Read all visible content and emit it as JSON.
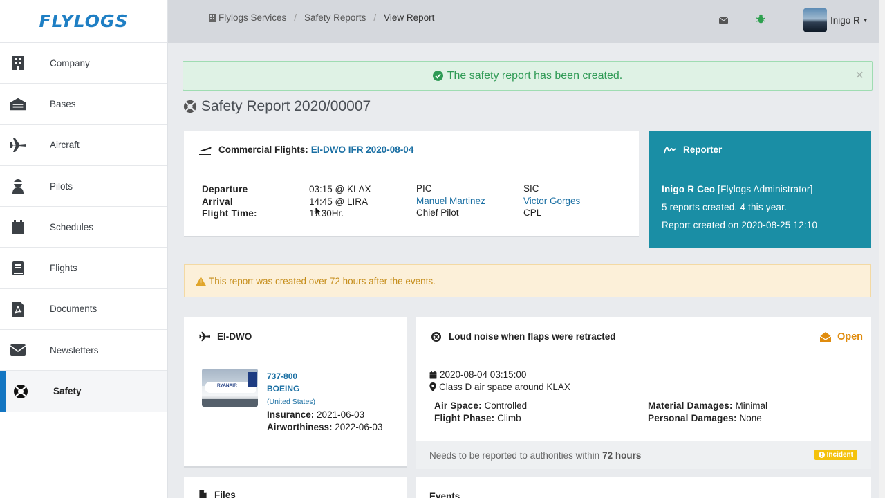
{
  "brand": {
    "logo_text": "FLYLOGS",
    "accent_color": "#1f7fc4"
  },
  "sidebar": {
    "items": [
      {
        "label": "Company",
        "icon": "building-icon"
      },
      {
        "label": "Bases",
        "icon": "hangar-icon"
      },
      {
        "label": "Aircraft",
        "icon": "plane-icon"
      },
      {
        "label": "Pilots",
        "icon": "pilot-icon"
      },
      {
        "label": "Schedules",
        "icon": "calendar-icon"
      },
      {
        "label": "Flights",
        "icon": "book-icon"
      },
      {
        "label": "Documents",
        "icon": "pdf-file-icon"
      },
      {
        "label": "Newsletters",
        "icon": "envelope-icon"
      },
      {
        "label": "Safety",
        "icon": "lifebuoy-icon",
        "active": true
      }
    ]
  },
  "topbar": {
    "breadcrumb": [
      "Flylogs Services",
      "Safety Reports",
      "View Report"
    ],
    "icons": [
      "mail-icon",
      "bug-icon"
    ],
    "user_name": "Inigo R"
  },
  "alert": {
    "message": "The safety report has been created.",
    "close": "×"
  },
  "page": {
    "title": "Safety Report 2020/00007"
  },
  "flight": {
    "label": "Commercial Flights:",
    "link": "EI-DWO IFR 2020-08-04",
    "departure_label": "Departure",
    "arrival_label": "Arrival",
    "flight_time_label": "Flight Time:",
    "departure": "03:15 @ KLAX",
    "arrival": "14:45 @ LIRA",
    "flight_time": "11:30Hr.",
    "pic_label": "PIC",
    "pic_name": "Manuel Martinez",
    "pic_role": "Chief Pilot",
    "sic_label": "SIC",
    "sic_name": "Victor Gorges",
    "sic_role": "CPL"
  },
  "reporter": {
    "title": "Reporter",
    "name": "Inigo R Ceo",
    "role": "[Flylogs Administrator]",
    "reports": "5 reports created. 4 this year.",
    "created": "Report created on 2020-08-25 12:10",
    "bg_color": "#1a8ea5"
  },
  "warning": {
    "message": "This report was created over 72 hours after the events."
  },
  "aircraft": {
    "registration": "EI-DWO",
    "model": "737-800",
    "maker": "BOEING",
    "country": "(United States)",
    "insurance_label": "Insurance:",
    "insurance": "2021-06-03",
    "airworthiness_label": "Airworthiness:",
    "airworthiness": "2022-06-03",
    "livery_text": "RYANAIR"
  },
  "event": {
    "title": "Loud noise when flaps were retracted",
    "status": "Open",
    "datetime": "2020-08-04 03:15:00",
    "location": "Class D air space around KLAX",
    "air_space_label": "Air Space:",
    "air_space": "Controlled",
    "flight_phase_label": "Flight Phase:",
    "flight_phase": "Climb",
    "material_label": "Material Damages:",
    "material": "Minimal",
    "personal_label": "Personal Damages:",
    "personal": "None",
    "footer_text": "Needs to be reported to authorities within",
    "footer_hours": "72 hours",
    "badge": "Incident"
  },
  "sections": {
    "files": "Files",
    "events": "Events"
  }
}
